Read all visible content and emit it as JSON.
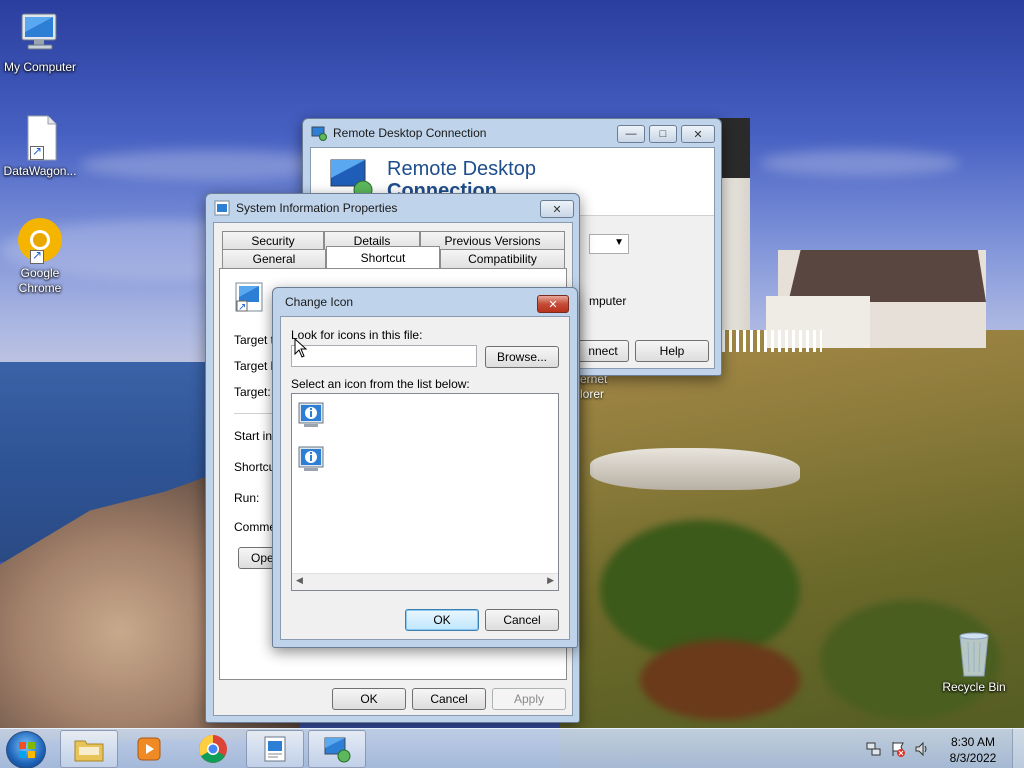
{
  "desktop": {
    "icons": [
      {
        "label": "My Computer",
        "icon": "computer-icon"
      },
      {
        "label": "DataWagon...",
        "icon": "document-shortcut-icon"
      },
      {
        "label": "Google Chrome",
        "icon": "chrome-canary-icon"
      },
      {
        "label": "Recycle Bin",
        "icon": "recycle-bin-icon"
      }
    ],
    "partial_icon_text": [
      "ernet",
      "lorer"
    ]
  },
  "rdc_window": {
    "title": "Remote Desktop Connection",
    "banner_line1": "Remote Desktop",
    "banner_line2": "Connection",
    "partial_computer_text": "mputer",
    "connect_label": "nnect",
    "help_label": "Help"
  },
  "props_window": {
    "title": "System Information Properties",
    "tabs_row1": [
      "Security",
      "Details",
      "Previous Versions"
    ],
    "tabs_row2": [
      "General",
      "Shortcut",
      "Compatibility"
    ],
    "active_tab": "Shortcut",
    "fields": [
      "Target ty",
      "Target lo",
      "Target:",
      "Start in:",
      "Shortcut",
      "Run:",
      "Commen"
    ],
    "open_button": "Ope",
    "ok_label": "OK",
    "cancel_label": "Cancel",
    "apply_label": "Apply"
  },
  "change_icon_dialog": {
    "title": "Change Icon",
    "look_label": "Look for icons in this file:",
    "file_value": "",
    "browse_label": "Browse...",
    "select_label": "Select an icon from the list below:",
    "icons": [
      "system-info-icon",
      "system-info-icon"
    ],
    "ok_label": "OK",
    "cancel_label": "Cancel"
  },
  "taskbar": {
    "items": [
      "start-orb",
      "file-explorer",
      "media-player",
      "chrome",
      "system-information",
      "remote-desktop"
    ],
    "clock_time": "8:30 AM",
    "clock_date": "8/3/2022"
  },
  "colors": {
    "accent_blue": "#1f4e8c",
    "dialog_close_red": "#c44c38",
    "default_button": "#3c7fb1"
  }
}
